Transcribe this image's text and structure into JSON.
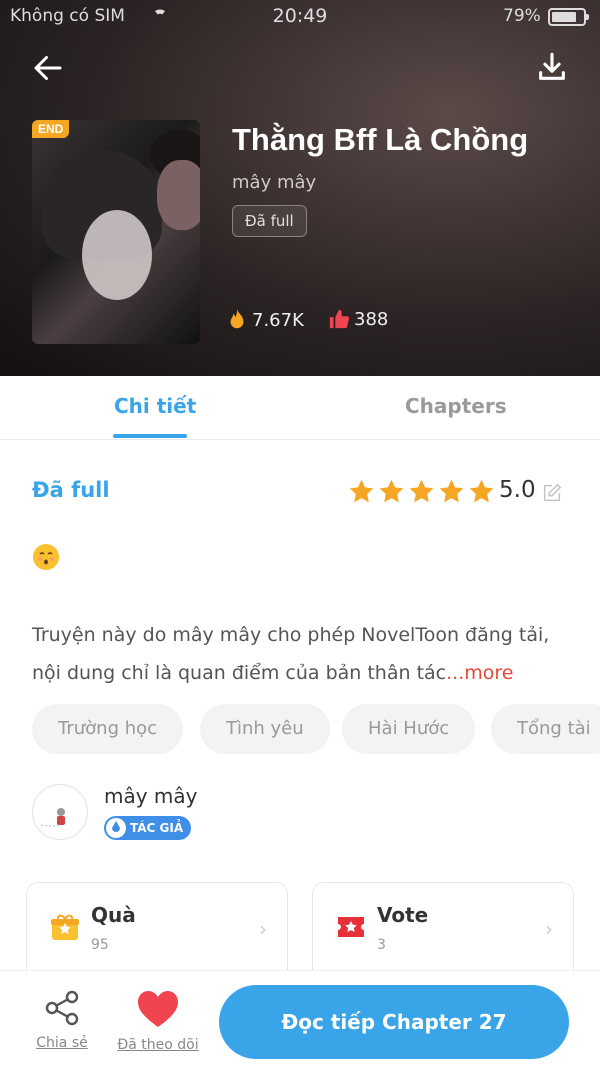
{
  "status_bar": {
    "carrier": "Không có SIM",
    "time": "20:49",
    "battery": "79%"
  },
  "book": {
    "badge": "END",
    "title": "Thằng Bff Là Chồng",
    "author": "mây mây",
    "status_chip": "Đã full",
    "views": "7.67K",
    "likes": "388"
  },
  "tabs": [
    {
      "label": "Chi tiết",
      "active": true
    },
    {
      "label": "Chapters",
      "active": false
    }
  ],
  "detail": {
    "status": "Đã full",
    "rating": "5.0",
    "stars": 5,
    "emoji": "kissing-face-icon",
    "description": "Truyện này do mây mây cho phép NovelToon đăng tải, nội dung chỉ là quan điểm của bản thân tác",
    "more": "...more",
    "tags": [
      "Trường học",
      "Tình yêu",
      "Hài Hước",
      "Tổng tài"
    ]
  },
  "author_block": {
    "name": "mây mây",
    "badge": "TÁC GIẢ"
  },
  "cards": {
    "gift": {
      "title": "Quà",
      "count": "95"
    },
    "vote": {
      "title": "Vote",
      "count": "3"
    }
  },
  "bottom_bar": {
    "share": "Chia sẻ",
    "follow": "Đã theo dõi",
    "read": "Đọc tiếp Chapter 27"
  },
  "colors": {
    "accent": "#3aa4e8",
    "more": "#e8483a",
    "badge": "#f5a623",
    "heart": "#f04550"
  }
}
